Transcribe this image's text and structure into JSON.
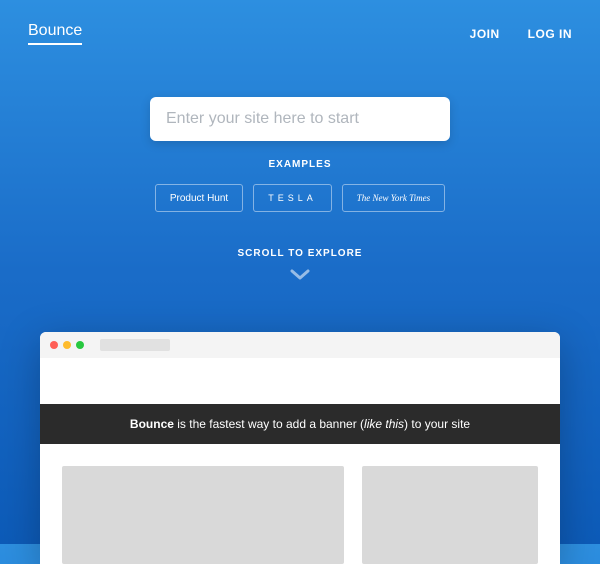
{
  "header": {
    "logo": "Bounce",
    "nav": {
      "join": "JOIN",
      "login": "LOG IN"
    }
  },
  "hero": {
    "input_placeholder": "Enter your site here to start",
    "examples_label": "EXAMPLES",
    "examples": {
      "product_hunt": "Product Hunt",
      "tesla": "TESLA",
      "nyt": "The New York Times"
    },
    "scroll_label": "SCROLL TO EXPLORE"
  },
  "preview": {
    "banner_bold": "Bounce",
    "banner_mid": " is the fastest way to add a banner (",
    "banner_italic": "like this",
    "banner_end": ") to your site"
  }
}
